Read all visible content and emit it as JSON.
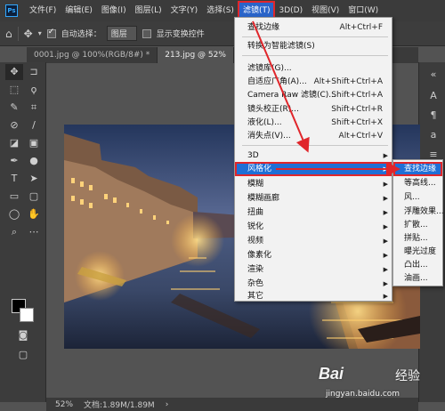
{
  "app": {
    "logo": "Ps"
  },
  "menubar": {
    "items": [
      "文件(F)",
      "编辑(E)",
      "图像(I)",
      "图层(L)",
      "文字(Y)",
      "选择(S)",
      "滤镜(T)",
      "3D(D)",
      "视图(V)",
      "窗口(W)"
    ]
  },
  "options": {
    "auto_select_label": "自动选择：",
    "auto_select_value": "图层",
    "show_transform_label": "显示变换控件"
  },
  "tabs": [
    "0001.jpg @ 100%(RGB/8#) *",
    "213.jpg @ 52%"
  ],
  "status": {
    "zoom": "52%",
    "doc": "文档:1.89M/1.89M"
  },
  "filter_menu": {
    "items": [
      {
        "label": "查找边缘",
        "shortcut": "Alt+Ctrl+F"
      },
      {
        "label": "转换为智能滤镜(S)",
        "shortcut": ""
      },
      {
        "label": "滤镜库(G)...",
        "shortcut": ""
      },
      {
        "label": "自适应广角(A)...",
        "shortcut": "Alt+Shift+Ctrl+A"
      },
      {
        "label": "Camera Raw 滤镜(C)...",
        "shortcut": "Shift+Ctrl+A"
      },
      {
        "label": "镜头校正(R)...",
        "shortcut": "Shift+Ctrl+R"
      },
      {
        "label": "液化(L)...",
        "shortcut": "Shift+Ctrl+X"
      },
      {
        "label": "消失点(V)...",
        "shortcut": "Alt+Ctrl+V"
      },
      {
        "label": "3D",
        "shortcut": ""
      },
      {
        "label": "风格化",
        "shortcut": ""
      },
      {
        "label": "模糊",
        "shortcut": ""
      },
      {
        "label": "模糊画廊",
        "shortcut": ""
      },
      {
        "label": "扭曲",
        "shortcut": ""
      },
      {
        "label": "锐化",
        "shortcut": ""
      },
      {
        "label": "视频",
        "shortcut": ""
      },
      {
        "label": "像素化",
        "shortcut": ""
      },
      {
        "label": "渲染",
        "shortcut": ""
      },
      {
        "label": "杂色",
        "shortcut": ""
      },
      {
        "label": "其它",
        "shortcut": ""
      }
    ]
  },
  "stylize_submenu": {
    "items": [
      "查找边缘",
      "等高线...",
      "风...",
      "浮雕效果...",
      "扩散...",
      "拼贴...",
      "曝光过度",
      "凸出...",
      "油画..."
    ]
  },
  "watermark": {
    "brand": "Bai",
    "brand2": "经验",
    "url": "jingyan.baidu.com"
  },
  "colors": {
    "highlight": "#1f6fd6",
    "annotation_red": "#e0262b",
    "ui_dark": "#3c3c3c"
  }
}
